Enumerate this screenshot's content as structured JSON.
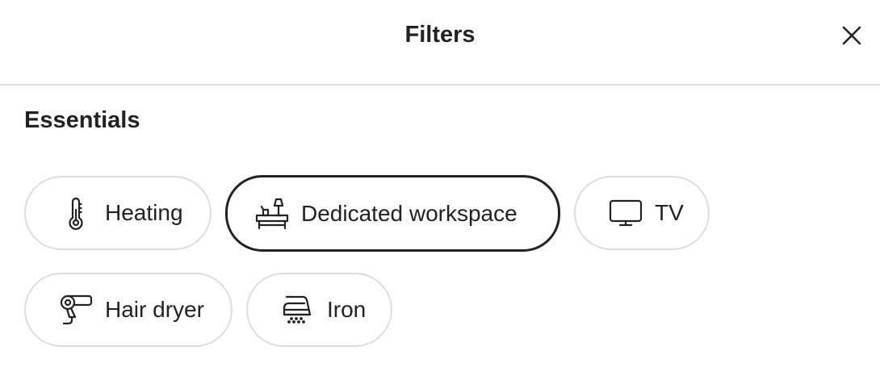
{
  "header": {
    "title": "Filters",
    "close_icon": "close-icon"
  },
  "section": {
    "title": "Essentials"
  },
  "amenities": [
    {
      "label": "Heating",
      "icon": "thermometer-icon",
      "selected": false
    },
    {
      "label": "Dedicated workspace",
      "icon": "desk-icon",
      "selected": true
    },
    {
      "label": "TV",
      "icon": "tv-icon",
      "selected": false
    },
    {
      "label": "Hair dryer",
      "icon": "hair-dryer-icon",
      "selected": false
    },
    {
      "label": "Iron",
      "icon": "iron-icon",
      "selected": false
    }
  ],
  "colors": {
    "text": "#222222",
    "border": "#dddddd",
    "selected_border": "#222222",
    "background": "#ffffff"
  }
}
